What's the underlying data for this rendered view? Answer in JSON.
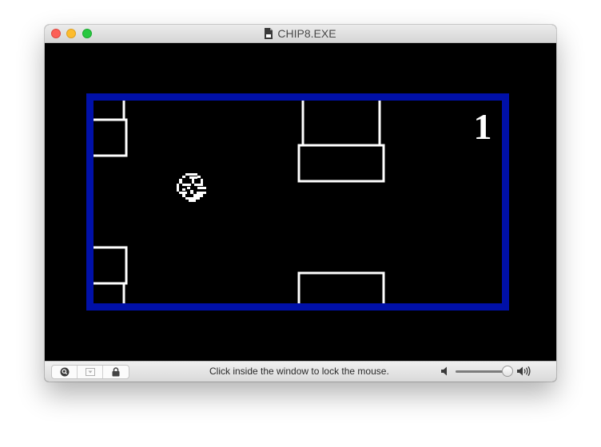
{
  "window": {
    "title": "CHIP8.EXE"
  },
  "game": {
    "score": "1",
    "border_color": "#0010a8",
    "background_color": "#000000",
    "pipe_color": "#ffffff"
  },
  "statusbar": {
    "message": "Click inside the window to lock the mouse.",
    "volume_level": 0.95
  }
}
